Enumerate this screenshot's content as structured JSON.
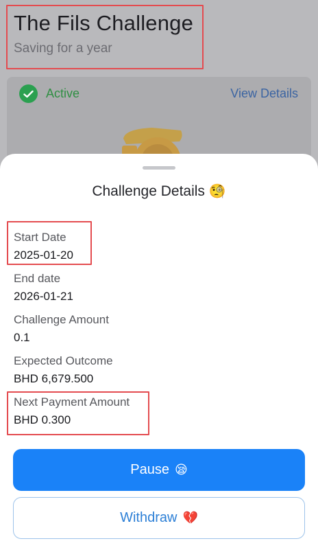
{
  "background": {
    "title": "The Fils Challenge",
    "subtitle": "Saving for a year",
    "status_label": "Active",
    "view_details_label": "View Details"
  },
  "sheet": {
    "title": "Challenge Details",
    "title_emoji": "🧐",
    "details": [
      {
        "label": "Start Date",
        "value": "2025-01-20"
      },
      {
        "label": "End date",
        "value": "2026-01-21"
      },
      {
        "label": "Challenge Amount",
        "value": "0.1"
      },
      {
        "label": "Expected Outcome",
        "value": "BHD 6,679.500"
      },
      {
        "label": "Next Payment Amount",
        "value": "BHD 0.300"
      }
    ],
    "pause_label": "Pause",
    "pause_emoji": "😪",
    "withdraw_label": "Withdraw",
    "withdraw_emoji": "💔"
  },
  "colors": {
    "primary": "#1a82f8",
    "active_green": "#2ba050",
    "highlight_red": "#e44b4f"
  }
}
